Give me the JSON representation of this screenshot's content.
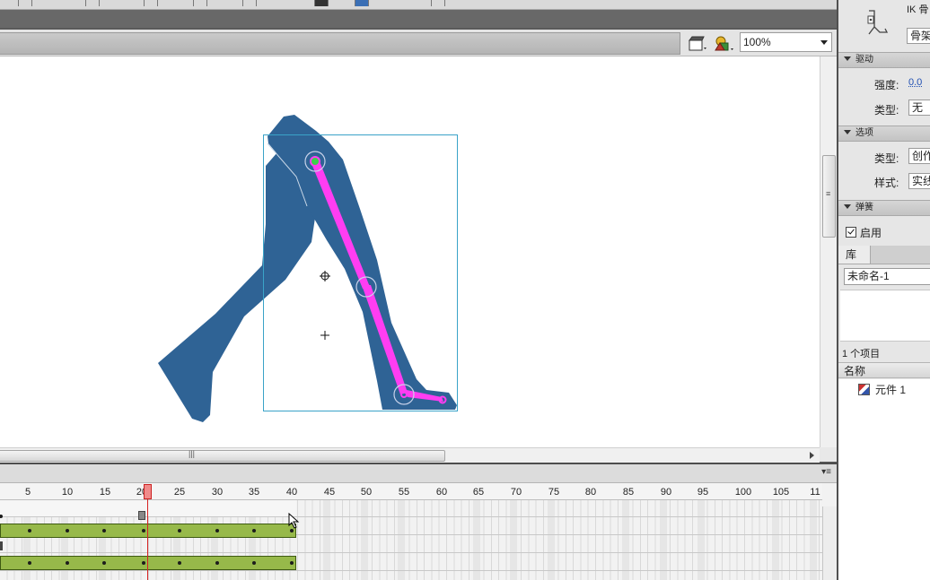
{
  "edit_bar": {
    "zoom_value": "100%"
  },
  "timeline": {
    "frame_numbers": [
      "5",
      "10",
      "15",
      "20",
      "25",
      "30",
      "35",
      "40",
      "45",
      "50",
      "55",
      "60",
      "65",
      "70",
      "75",
      "80",
      "85",
      "90",
      "95",
      "100",
      "105",
      "11"
    ],
    "current_frame": 21
  },
  "properties_panel": {
    "ik_title": "IK 骨",
    "bone_name_value": "骨架",
    "drive_section": "驱动",
    "strength_label": "强度:",
    "strength_value": "0.0",
    "damping_type_label": "类型:",
    "damping_type_value": "无",
    "options_section": "选项",
    "options_type_label": "类型:",
    "options_type_value": "创作",
    "style_label": "样式:",
    "style_value": "实线",
    "spring_section": "弹簧",
    "enable_label": "启用"
  },
  "library_panel": {
    "tab_label": "库",
    "document_name": "未命名-1",
    "item_count": "1 个项目",
    "name_column": "名称",
    "items": [
      "元件 1"
    ]
  },
  "colors": {
    "leg": "#2f6395",
    "bone": "#ff3df2",
    "tween": "#97b94a",
    "playhead": "#d62222"
  }
}
